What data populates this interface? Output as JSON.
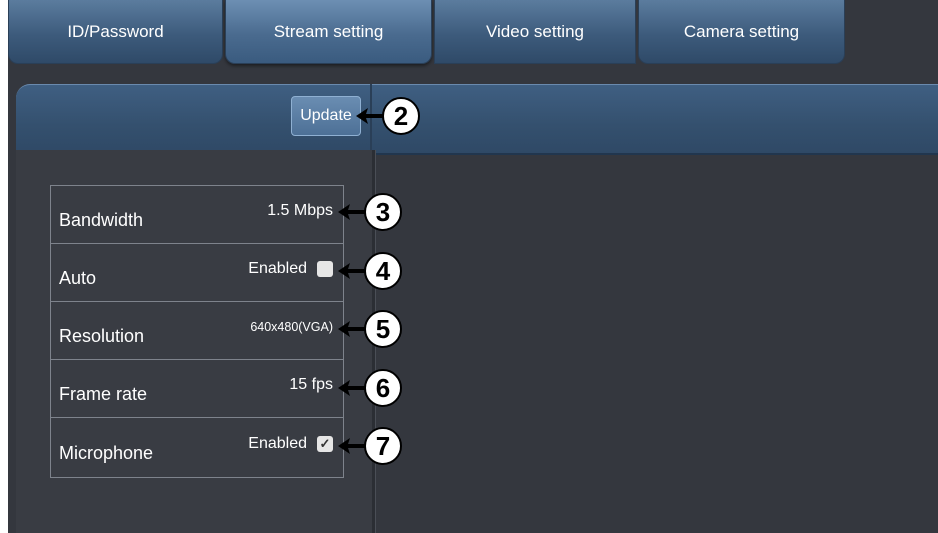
{
  "tabs": [
    {
      "label": "ID/Password"
    },
    {
      "label": "Stream setting"
    },
    {
      "label": "Video setting"
    },
    {
      "label": "Camera setting"
    }
  ],
  "active_tab": "Stream setting",
  "update_button": {
    "label": "Update"
  },
  "settings": [
    {
      "label": "Bandwidth",
      "value": "1.5 Mbps"
    },
    {
      "label": "Auto",
      "value": "Enabled",
      "checked": false
    },
    {
      "label": "Resolution",
      "value": "640x480(VGA)"
    },
    {
      "label": "Frame rate",
      "value": "15 fps"
    },
    {
      "label": "Microphone",
      "value": "Enabled",
      "checked": true
    }
  ],
  "callouts": [
    "2",
    "3",
    "4",
    "5",
    "6",
    "7"
  ],
  "colors": {
    "background": "#34373e",
    "tab_blue": "#3d5b7c",
    "header_blue": "#34506e",
    "text": "#ffffff"
  }
}
